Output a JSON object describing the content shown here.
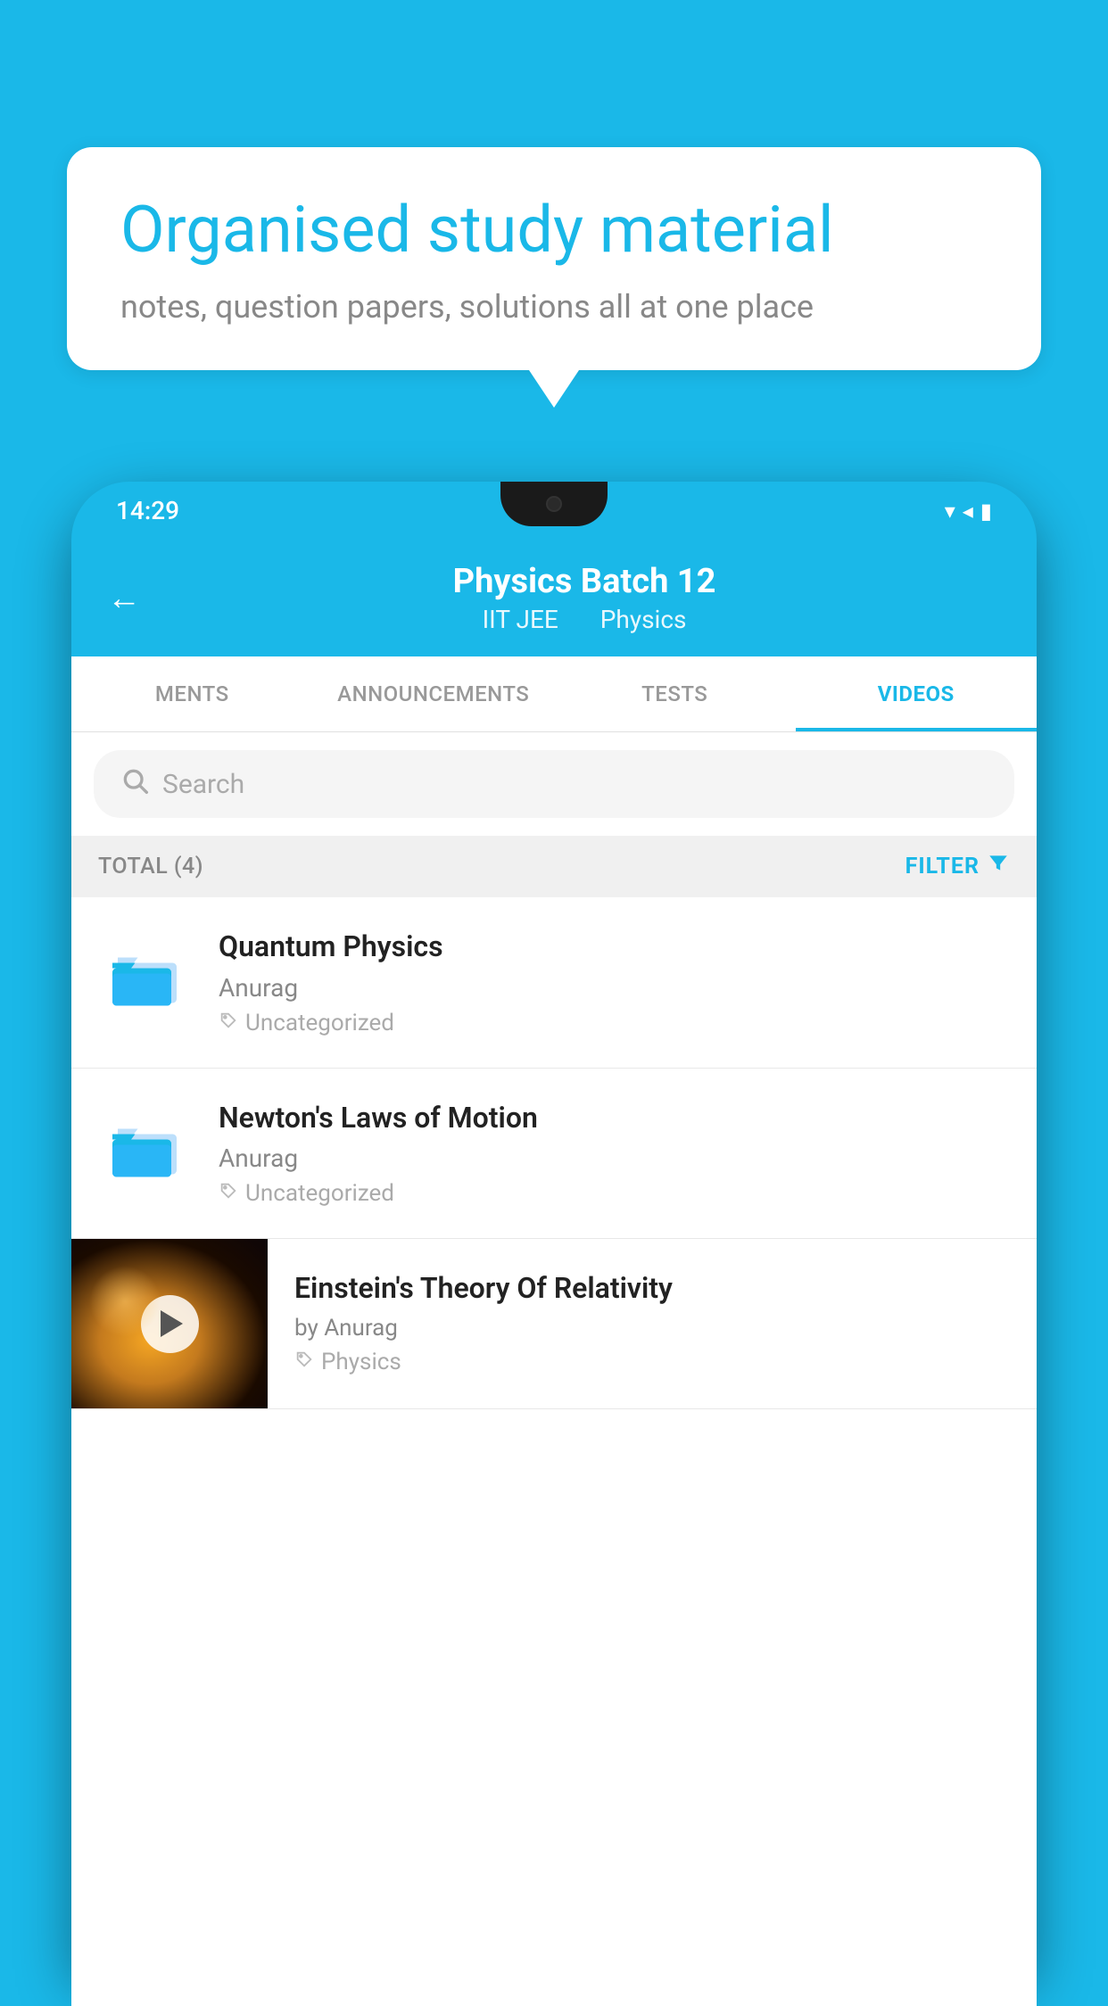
{
  "background_color": "#1ab8e8",
  "speech_bubble": {
    "title": "Organised study material",
    "subtitle": "notes, question papers, solutions all at one place"
  },
  "status_bar": {
    "time": "14:29",
    "wifi": "▾",
    "signal": "◂",
    "battery": "▮"
  },
  "app_header": {
    "back_label": "←",
    "title": "Physics Batch 12",
    "subtitle_part1": "IIT JEE",
    "subtitle_part2": "Physics"
  },
  "tabs": [
    {
      "label": "MENTS",
      "active": false
    },
    {
      "label": "ANNOUNCEMENTS",
      "active": false
    },
    {
      "label": "TESTS",
      "active": false
    },
    {
      "label": "VIDEOS",
      "active": true
    }
  ],
  "search": {
    "placeholder": "Search"
  },
  "filter_row": {
    "total_label": "TOTAL (4)",
    "filter_label": "FILTER"
  },
  "videos": [
    {
      "title": "Quantum Physics",
      "author": "Anurag",
      "tag": "Uncategorized",
      "has_thumb": false
    },
    {
      "title": "Newton's Laws of Motion",
      "author": "Anurag",
      "tag": "Uncategorized",
      "has_thumb": false
    },
    {
      "title": "Einstein's Theory Of Relativity",
      "author": "by Anurag",
      "tag": "Physics",
      "has_thumb": true
    }
  ]
}
